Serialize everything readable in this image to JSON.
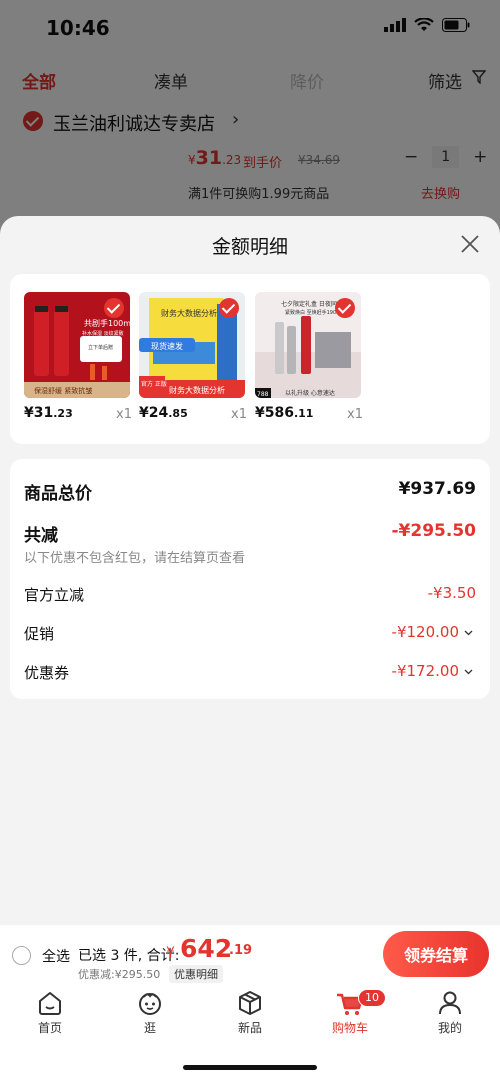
{
  "status_bar": {
    "time": "10:46"
  },
  "cart_tabs": {
    "all": "全部",
    "combo": "凑单",
    "price_drop": "降价",
    "filter": "筛选"
  },
  "shop": {
    "name": "玉兰油利诚达专卖店",
    "price_currency": "¥",
    "price_int": "31",
    "price_dec": ".23",
    "price_label": "到手价",
    "original_price": "¥34.69",
    "quantity": "1",
    "promo_text": "满1件可换购1.99元商品",
    "exchange_link": "去换购"
  },
  "sheet": {
    "title": "金额明细",
    "goods": [
      {
        "price_int": "¥31",
        "price_dec": ".23",
        "qty": "x1"
      },
      {
        "price_int": "¥24",
        "price_dec": ".85",
        "qty": "x1"
      },
      {
        "price_int": "¥586",
        "price_dec": ".11",
        "qty": "x1"
      }
    ],
    "good1_img_text": [
      "共剧手100ml",
      "补水保湿 淡纹紧致",
      "立下单后赠",
      "保湿舒缓 紧致抗皱"
    ],
    "good2_img_text": [
      "财务大数据分析",
      "现货速发",
      "官方 正版",
      "财务大数据分析"
    ],
    "good3_img_text": [
      "七夕限定礼盒 日夜同修",
      "紧致焕白 至焕赶手190ml",
      "以礼升级 心意速达",
      "788"
    ],
    "summary": {
      "total_label": "商品总价",
      "total_value": "¥937.69",
      "reduce_label": "共减",
      "reduce_value": "-¥295.50",
      "reduce_note": "以下优惠不包含红包，请在结算页查看",
      "official_label": "官方立减",
      "official_value": "-¥3.50",
      "promo_label": "促销",
      "promo_value": "-¥120.00",
      "coupon_label": "优惠券",
      "coupon_value": "-¥172.00"
    }
  },
  "bottom_bar": {
    "select_all": "全选",
    "selected": "已选 3 件, 合计:",
    "currency": "¥",
    "total_int": "642",
    "total_dec": ".19",
    "discount": "优惠减:¥295.50",
    "detail": "优惠明细",
    "checkout": "领券结算"
  },
  "tabbar": {
    "items": [
      {
        "label": "首页"
      },
      {
        "label": "逛"
      },
      {
        "label": "新品"
      },
      {
        "label": "购物车",
        "badge": "10"
      },
      {
        "label": "我的"
      }
    ]
  },
  "colors": {
    "accent": "#e3342f",
    "overlay": "rgba(0,0,0,0.5)"
  }
}
